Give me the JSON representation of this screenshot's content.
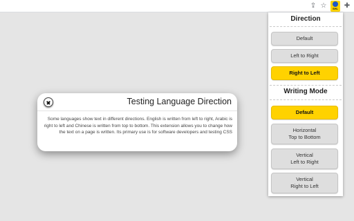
{
  "toolbar": {
    "icons": [
      "share-icon",
      "star-icon",
      "extension-language-direction-icon",
      "puzzle-icon"
    ],
    "share_glyph": "⇪",
    "star_glyph": "☆",
    "puzzle_glyph": "✚",
    "extension_badge_text": "SHL"
  },
  "panel": {
    "direction_title": "Direction",
    "direction_buttons": [
      "Default",
      "Left to Right",
      "Right to Left"
    ],
    "direction_active": "Right to Left",
    "writing_mode_title": "Writing Mode",
    "writing_mode_buttons": [
      "Default",
      "Horizontal\nTop to Bottom",
      "Vertical\nLeft to Right",
      "Vertical\nRight to Left"
    ],
    "writing_mode_active": "Default"
  },
  "dialog": {
    "title": "Testing Language Direction",
    "body": "Some languages show text in different directions. English is written from left to right, Arabic is right to left and Chinese is written from top to bottom. This extension allows you to change how the text on a page is written. Its primary use is for software developers and testing CSS"
  },
  "colors": {
    "accent": "#ffd200",
    "background": "#e5e5e5",
    "button": "#dedede"
  }
}
